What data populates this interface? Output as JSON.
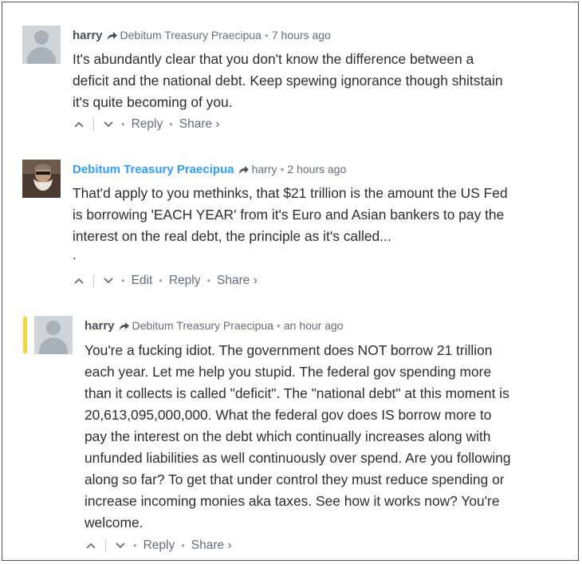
{
  "comments": [
    {
      "author": "harry",
      "reply_to": "Debitum Treasury Praecipua",
      "time": "7 hours ago",
      "text_lines": [
        "It's abundantly clear that you don't know the difference between a",
        "deficit and the national debt. Keep spewing ignorance though shitstain",
        "it's quite becoming of you."
      ],
      "actions": {
        "reply": "Reply",
        "share": "Share ›"
      }
    },
    {
      "author": "Debitum Treasury Praecipua",
      "reply_to": "harry",
      "time": "2 hours ago",
      "text_lines": [
        "That'd apply to you methinks, that $21 trillion is the amount the US Fed",
        "is borrowing 'EACH YEAR' from it's Euro and Asian bankers to pay the",
        "interest on the real debt, the principle as it's called..."
      ],
      "trailing": ".",
      "actions": {
        "edit": "Edit",
        "reply": "Reply",
        "share": "Share ›"
      }
    },
    {
      "author": "harry",
      "reply_to": "Debitum Treasury Praecipua",
      "time": "an hour ago",
      "text_lines": [
        "You're a fucking idiot. The government does NOT borrow 21 trillion",
        "each year. Let me help you stupid. The federal gov spending more",
        "than it collects is called \"deficit\". The \"national debt\" at this moment is",
        "20,613,095,000,000. What the federal gov does IS borrow more to",
        "pay the interest on the debt which continually increases along with",
        "unfunded liabilities as well continuously over spend. Are you following",
        "along so far? To get that under control they must reduce spending or",
        "increase incoming monies aka taxes. See how it works now? You're",
        "welcome."
      ],
      "actions": {
        "reply": "Reply",
        "share": "Share ›"
      }
    }
  ],
  "icons": {
    "upvote": "chevron-up-icon",
    "downvote": "chevron-down-icon",
    "reply_arrow": "reply-arrow-icon"
  },
  "colors": {
    "highlight_bar": "#f7d23c",
    "author_link": "#2e9fff",
    "meta_text": "#656c7a"
  }
}
